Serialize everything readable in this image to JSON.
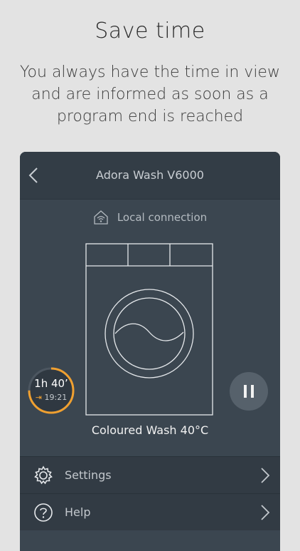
{
  "headline": "Save time",
  "subline": "You always have the time in view and are informed as soon as a program end is reached",
  "app": {
    "title": "Adora Wash V6000",
    "connection": "Local connection",
    "timer": {
      "remaining": "1h 40’",
      "end_time": "19:21",
      "progress": 0.75,
      "color": "#f0a030"
    },
    "program": "Coloured Wash 40°C",
    "menu": [
      {
        "label": "Settings",
        "icon": "gear-icon"
      },
      {
        "label": "Help",
        "icon": "question-icon"
      }
    ]
  }
}
